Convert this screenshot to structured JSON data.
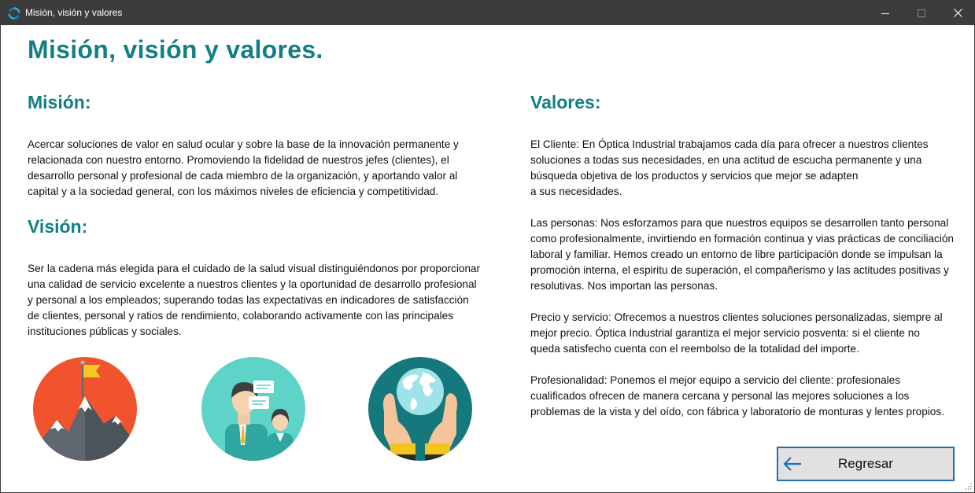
{
  "window": {
    "title": "Misión, visión y valores"
  },
  "page": {
    "title": "Misión, visión y valores."
  },
  "mision": {
    "heading": "Misión:",
    "lines": [
      "Acercar soluciones de valor en salud ocular y sobre la base de la innovación permanente y",
      "relacionada con nuestro entorno. Promoviendo la fidelidad de nuestros jefes (clientes), el",
      "desarrollo personal y profesional de cada miembro de la organización, y aportando valor al",
      "capital y a la sociedad general, con los máximos niveles de eficiencia y competitividad."
    ]
  },
  "vision": {
    "heading": "Visión:",
    "lines": [
      "Ser la cadena más elegida para el cuidado de la salud visual distinguiéndonos por proporcionar",
      "una calidad de servicio excelente a nuestros clientes y la oportunidad de desarrollo profesional",
      "y personal a los empleados; superando todas las expectativas en indicadores de satisfacción",
      "de clientes, personal y ratios de rendimiento, colaborando activamente con las principales",
      "instituciones públicas y sociales."
    ]
  },
  "valores": {
    "heading": "Valores:",
    "cliente": [
      "El Cliente: En Óptica Industrial trabajamos cada día para ofrecer a nuestros clientes",
      "soluciones a todas sus necesidades, en una actitud de escucha permanente y una",
      "búsqueda objetiva de los productos y servicios que mejor se adapten",
      "a sus necesidades."
    ],
    "personas": [
      "Las personas: Nos esforzamos para que nuestros equipos se desarrollen tanto personal",
      "como profesionalmente, invirtiendo en formación continua y vias prácticas de conciliación",
      "laboral y familiar. Hemos creado un entorno de libre participación donde se impulsan la",
      "promoción interna, el espiritu de superación, el compañerismo y las actitudes positivas y",
      "resolutivas. Nos importan las personas."
    ],
    "precio": [
      "Precio y servicio: Ofrecemos a nuestros clientes soluciones personalizadas, siempre al",
      "mejor precio. Óptica Industrial garantiza el mejor servicio posventa: si el cliente no",
      "queda satisfecho cuenta con el reembolso de la totalidad del importe."
    ],
    "profesionalidad": [
      "Profesionalidad: Ponemos el mejor equipo a servicio del cliente: profesionales",
      "cualificados ofrecen de manera cercana y personal las mejores soluciones a los",
      "problemas de la vista y del oído, con fábrica y laboratorio de monturas y lentes propios."
    ]
  },
  "buttons": {
    "regresar": "Regresar"
  },
  "icons": {
    "illustrations": [
      "mountain-flag-icon",
      "business-people-icon",
      "hands-globe-icon"
    ],
    "back": "arrow-left-icon"
  },
  "colors": {
    "heading": "#127f85",
    "titlebar": "#3c3c3c",
    "button_border": "#1f6fb5",
    "button_bg": "#e1e1e1"
  }
}
